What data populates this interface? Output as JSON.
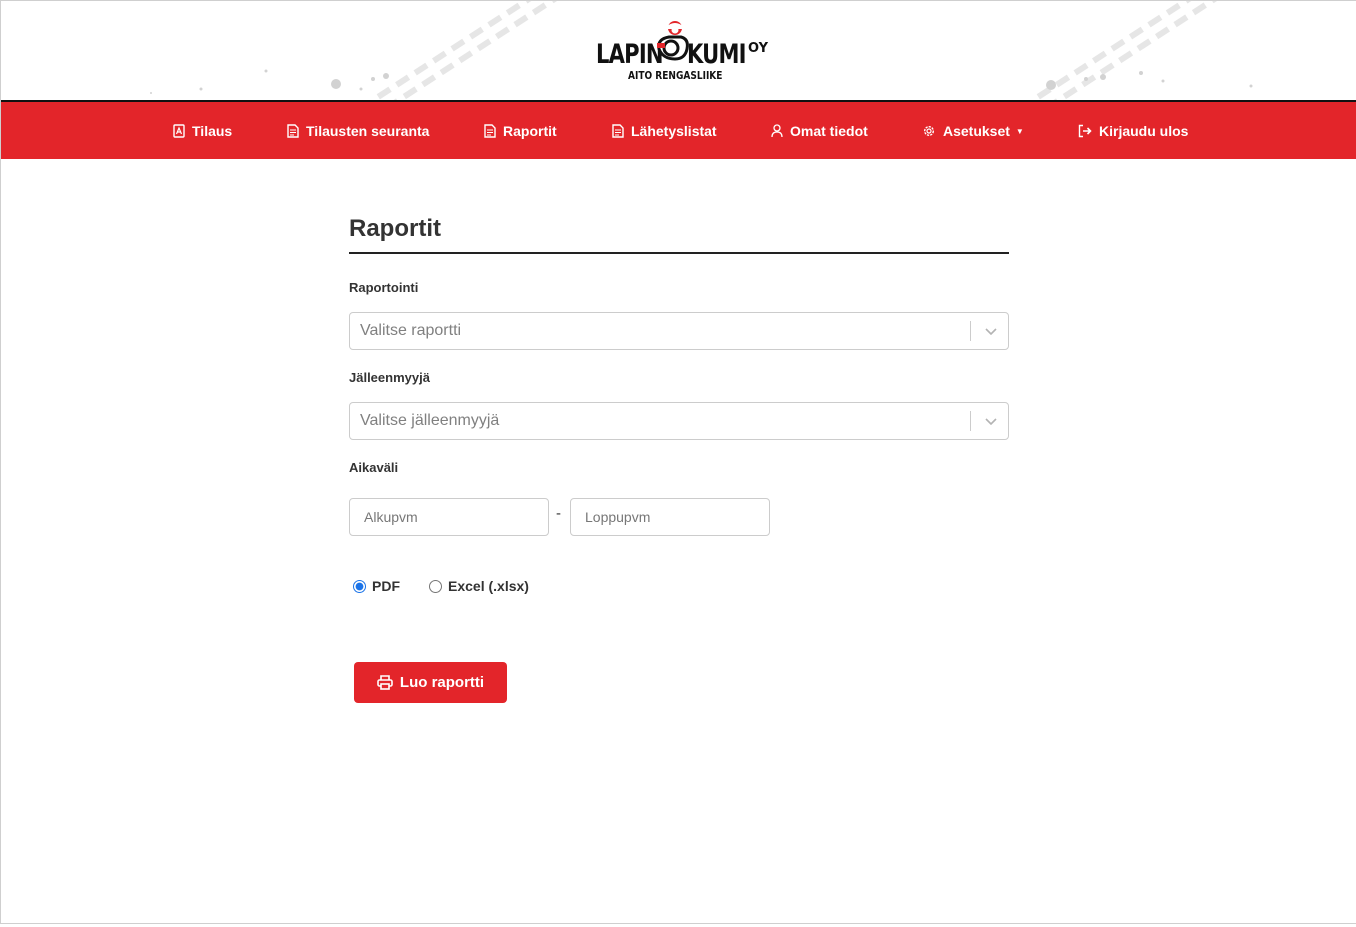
{
  "brand": {
    "name_left": "LAPIN",
    "name_right": "KUMI",
    "suffix": "OY",
    "tagline": "AITO RENGASLIIKE"
  },
  "colors": {
    "accent": "#e3252a",
    "radio_selected": "#1a73e8"
  },
  "nav": {
    "items": [
      {
        "label": "Tilaus",
        "icon": "clipboard-icon"
      },
      {
        "label": "Tilausten seuranta",
        "icon": "document-icon"
      },
      {
        "label": "Raportit",
        "icon": "document-icon"
      },
      {
        "label": "Lähetyslistat",
        "icon": "document-icon"
      },
      {
        "label": "Omat tiedot",
        "icon": "user-icon"
      },
      {
        "label": "Asetukset",
        "icon": "gear-icon",
        "has_dropdown": true
      },
      {
        "label": "Kirjaudu ulos",
        "icon": "logout-icon"
      }
    ]
  },
  "page": {
    "title": "Raportit",
    "report_label": "Raportointi",
    "report_placeholder": "Valitse raportti",
    "reseller_label": "Jälleenmyyjä",
    "reseller_placeholder": "Valitse jälleenmyyjä",
    "period_label": "Aikaväli",
    "start_placeholder": "Alkupvm",
    "end_placeholder": "Loppupvm",
    "separator": "-",
    "formats": [
      {
        "label": "PDF",
        "selected": true
      },
      {
        "label": "Excel (.xlsx)",
        "selected": false
      }
    ],
    "submit_label": "Luo raportti"
  }
}
